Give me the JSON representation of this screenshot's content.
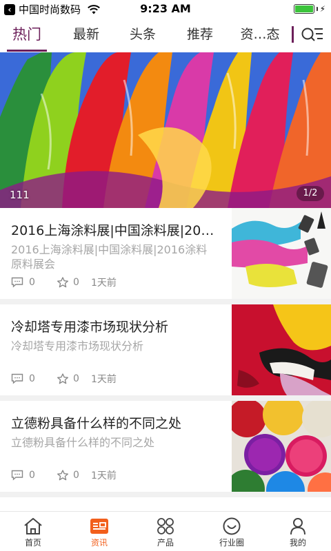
{
  "status_bar": {
    "carrier": "中国时尚数码",
    "time": "9:23 AM",
    "battery_level": 1.0
  },
  "tabs": [
    {
      "label": "热门",
      "active": true
    },
    {
      "label": "最新",
      "active": false
    },
    {
      "label": "头条",
      "active": false
    },
    {
      "label": "推荐",
      "active": false
    },
    {
      "label": "资…态",
      "active": false
    }
  ],
  "banner": {
    "caption": "111",
    "indicator": "1/2"
  },
  "articles": [
    {
      "title": "2016上海涂料展|中国涂料展|201...",
      "summary": "2016上海涂料展|中国涂料展|2016涂料原料展会",
      "comments": "0",
      "favorites": "0",
      "time": "1天前"
    },
    {
      "title": "冷却塔专用漆市场现状分析",
      "summary": "冷却塔专用漆市场现状分析",
      "comments": "0",
      "favorites": "0",
      "time": "1天前"
    },
    {
      "title": "立德粉具备什么样的不同之处",
      "summary": "立德粉具备什么样的不同之处",
      "comments": "0",
      "favorites": "0",
      "time": "1天前"
    }
  ],
  "bottom_nav": [
    {
      "label": "首页",
      "icon": "home-icon",
      "active": false
    },
    {
      "label": "资讯",
      "icon": "news-icon",
      "active": true
    },
    {
      "label": "产品",
      "icon": "grid-icon",
      "active": false
    },
    {
      "label": "行业圈",
      "icon": "smile-icon",
      "active": false
    },
    {
      "label": "我的",
      "icon": "person-icon",
      "active": false
    }
  ],
  "colors": {
    "accent": "#6c1f5a",
    "nav_active": "#f25f1c",
    "muted_text": "#a6a6a6"
  }
}
